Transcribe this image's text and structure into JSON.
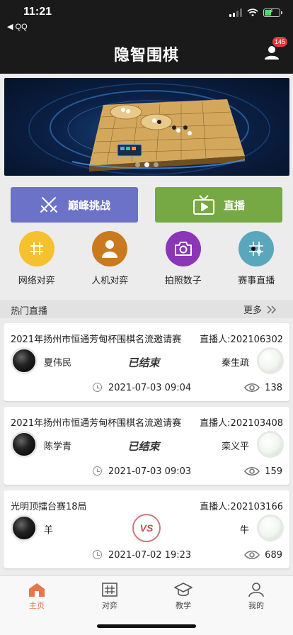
{
  "status_bar": {
    "time": "11:21",
    "back_app": "◀ QQ"
  },
  "header": {
    "logo": "隐智围棋",
    "notification_count": "145"
  },
  "banner": {
    "active_index": 1,
    "dot_count": 3
  },
  "actions": {
    "challenge_label": "巅峰挑战",
    "live_label": "直播"
  },
  "features": [
    {
      "label": "网络对弈",
      "icon": "grid-icon",
      "color": "#f5c12e"
    },
    {
      "label": "人机对弈",
      "icon": "person-icon",
      "color": "#c97a1e"
    },
    {
      "label": "拍照数子",
      "icon": "camera-icon",
      "color": "#8a36b7"
    },
    {
      "label": "赛事直播",
      "icon": "board-icon",
      "color": "#5aa7bb"
    }
  ],
  "hot_live": {
    "title": "热门直播",
    "more_label": "更多"
  },
  "games": [
    {
      "title": "2021年扬州市恒通芳甸杯围棋名流邀请赛",
      "host": "直播人:202106302",
      "black_player": "夏伟民",
      "white_player": "秦生疏",
      "status": "已结束",
      "time": "2021-07-03 09:04",
      "views": "138"
    },
    {
      "title": "2021年扬州市恒通芳甸杯围棋名流邀请赛",
      "host": "直播人:202103408",
      "black_player": "陈学青",
      "white_player": "栾义平",
      "status": "已结束",
      "time": "2021-07-03 09:03",
      "views": "159"
    },
    {
      "title": "光明顶擂台赛18局",
      "host": "直播人:202103166",
      "black_player": "羊",
      "white_player": "牛",
      "status": "VS",
      "time": "2021-07-02 19:23",
      "views": "689"
    }
  ],
  "tabs": [
    {
      "label": "主页",
      "active": true
    },
    {
      "label": "对弈",
      "active": false
    },
    {
      "label": "教学",
      "active": false
    },
    {
      "label": "我的",
      "active": false
    }
  ],
  "colors": {
    "accent": "#e8764a",
    "challenge": "#6b72c8",
    "live": "#76a844"
  }
}
